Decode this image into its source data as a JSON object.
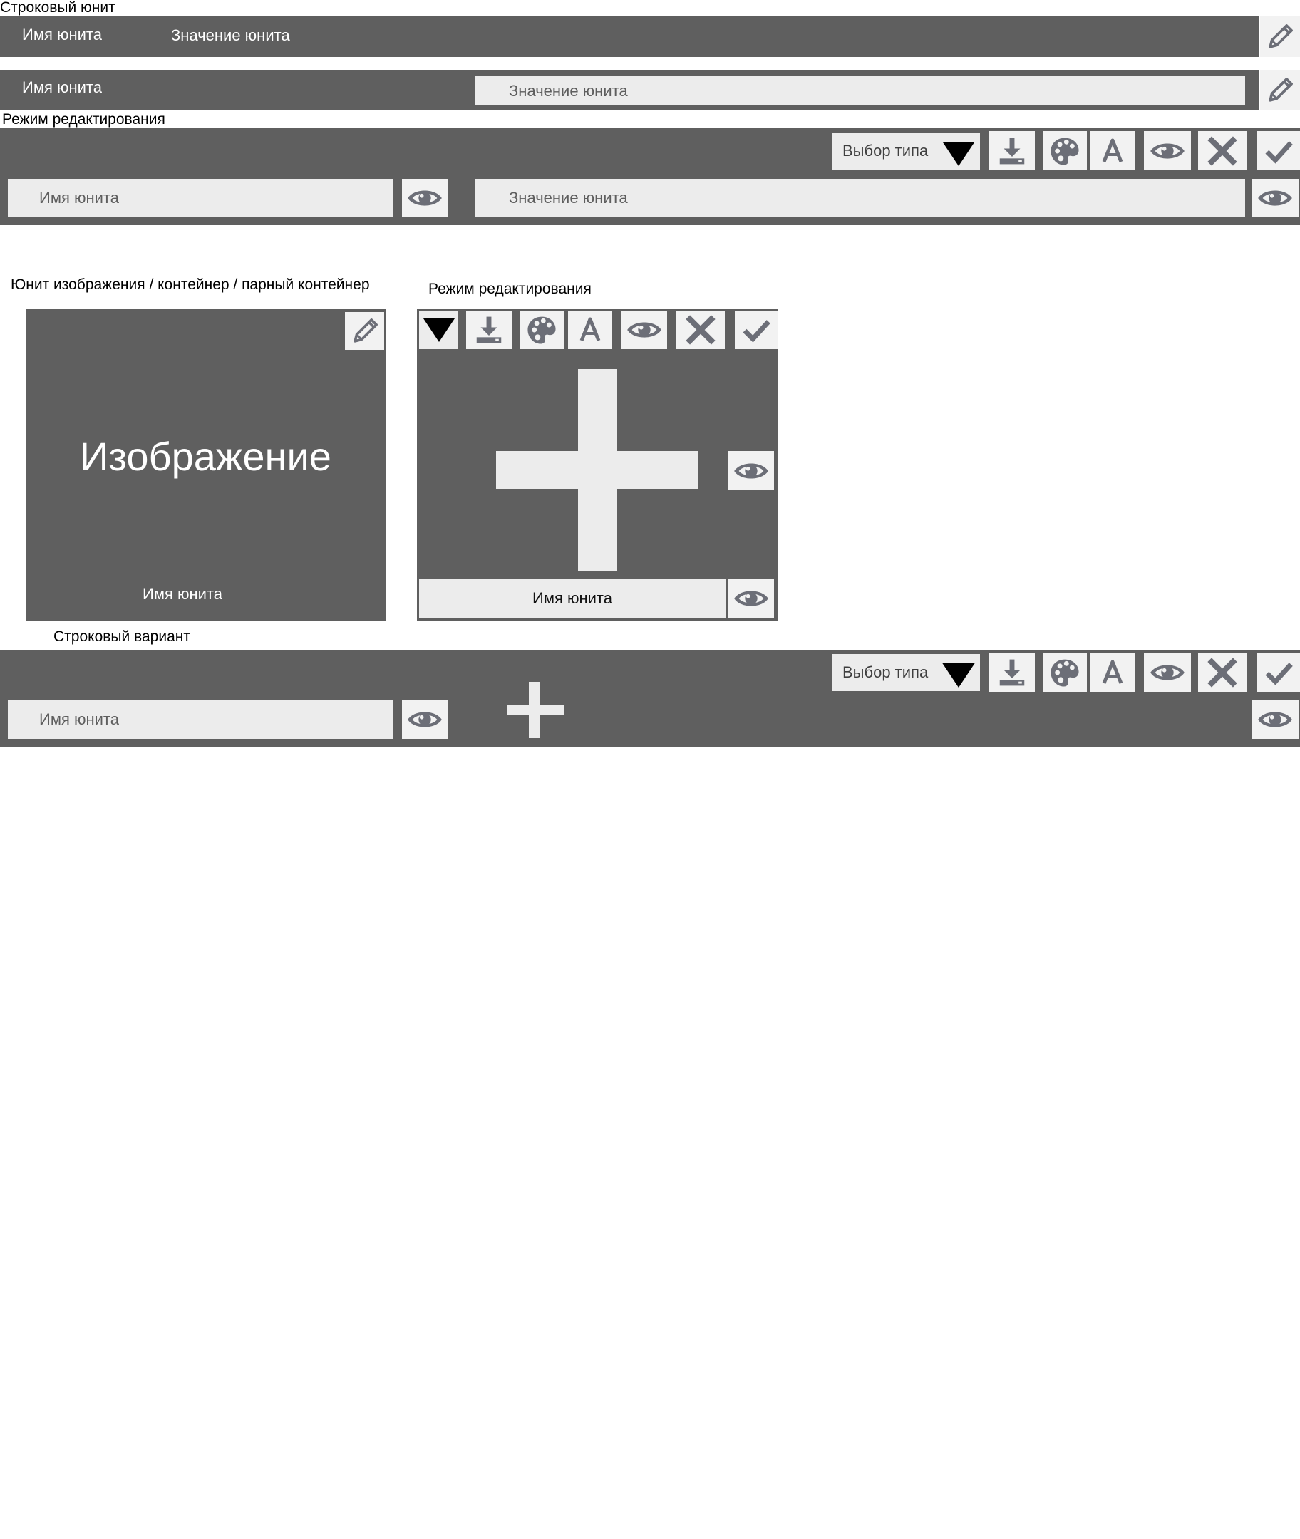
{
  "colors": {
    "bar": "#5f5f5f",
    "field": "#ececec",
    "button": "#f2f2f2",
    "icon": "#6c6e77",
    "white_text": "#ffffff"
  },
  "row_unit": {
    "caption": "Строковый юнит",
    "view1": {
      "name": "Имя юнита",
      "value": "Значение юнита",
      "edit_icon": "pencil-icon"
    },
    "view2": {
      "name": "Имя юнита",
      "value": "Значение юнита",
      "edit_icon": "pencil-icon"
    },
    "edit_caption": "Режим редактирования",
    "edit": {
      "type_select": "Выбор типа",
      "toolbar_icons": [
        "download-icon",
        "palette-icon",
        "font-icon",
        "eye-icon",
        "close-icon",
        "check-icon"
      ],
      "name_field": "Имя юнита",
      "value_field": "Значение юнита"
    }
  },
  "image_unit": {
    "caption": "Юнит изображения / контейнер / парный контейнер",
    "image_label": "Изображение",
    "name": "Имя юнита",
    "edit_caption": "Режим редактирования",
    "edit_name": "Имя юнита",
    "toolbar_icons": [
      "chevron-down-icon",
      "download-icon",
      "palette-icon",
      "font-icon",
      "eye-icon",
      "close-icon",
      "check-icon"
    ]
  },
  "row_variant": {
    "caption": "Строковый вариант",
    "type_select": "Выбор типа",
    "name_field": "Имя юнита"
  }
}
